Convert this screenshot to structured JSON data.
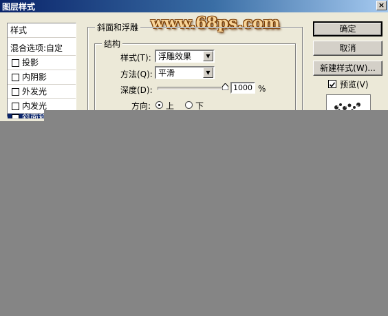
{
  "window": {
    "title": "图层样式",
    "close_label": "×"
  },
  "watermark": "www.68ps.com",
  "sidebar": {
    "header": "样式",
    "items": [
      {
        "label": "混合选项:自定",
        "has_checkbox": false,
        "checked": false
      },
      {
        "label": "投影",
        "has_checkbox": true,
        "checked": false
      },
      {
        "label": "内阴影",
        "has_checkbox": true,
        "checked": false
      },
      {
        "label": "外发光",
        "has_checkbox": true,
        "checked": false
      },
      {
        "label": "内发光",
        "has_checkbox": true,
        "checked": false
      },
      {
        "label": "斜面和",
        "has_checkbox": true,
        "checked": true,
        "selected": true
      }
    ]
  },
  "panel": {
    "section_title": "斜面和浮雕",
    "group_title": "结构",
    "style_label": "样式(T):",
    "style_value": "浮雕效果",
    "technique_label": "方法(Q):",
    "technique_value": "平滑",
    "depth_label": "深度(D):",
    "depth_value": "1000",
    "depth_unit": "%",
    "depth_fraction": 1.0,
    "direction_label": "方向:",
    "direction_up": "上",
    "direction_down": "下",
    "direction_selected": "up"
  },
  "buttons": {
    "ok": "确定",
    "cancel": "取消",
    "new_style": "新建样式(W)...",
    "preview_label": "预览(V)",
    "preview_checked": true
  }
}
